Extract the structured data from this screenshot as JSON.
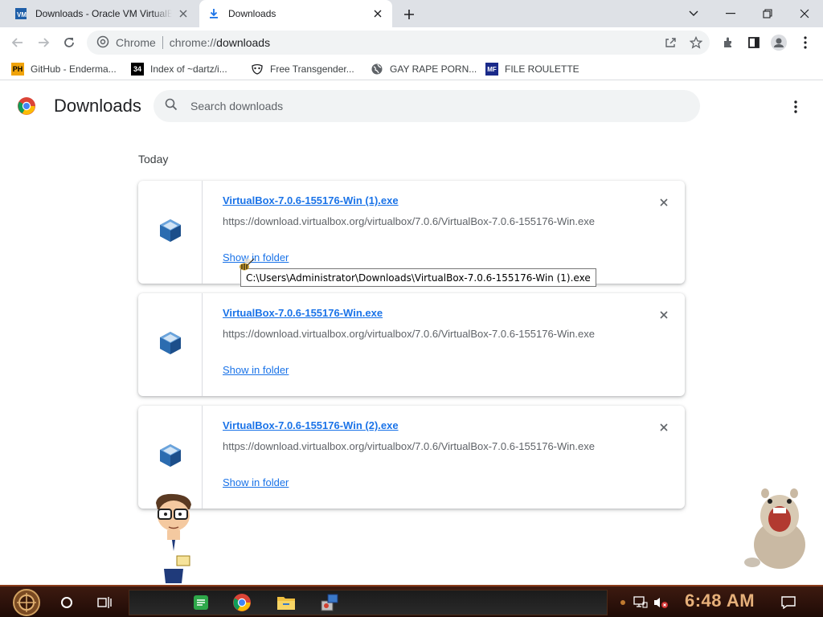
{
  "browser": {
    "tabs": [
      {
        "title": "Downloads - Oracle VM VirtualBox",
        "active": false,
        "favicon": "virtualbox-manual-icon"
      },
      {
        "title": "Downloads",
        "active": true,
        "favicon": "download-icon"
      }
    ],
    "omnibox": {
      "chip": "Chrome",
      "scheme": "chrome://",
      "path": "downloads"
    }
  },
  "bookmarks": [
    {
      "label": "GitHub - Enderma...",
      "icon": "PH"
    },
    {
      "label": "Index of ~dartz/i...",
      "icon": "34"
    },
    {
      "label": "Free Transgender...",
      "icon": "mask-icon"
    },
    {
      "label": "GAY RAPE PORN...",
      "icon": "globe-icon"
    },
    {
      "label": "FILE ROULETTE",
      "icon": "MF"
    }
  ],
  "downloads_page": {
    "title": "Downloads",
    "search_placeholder": "Search downloads",
    "date_label": "Today",
    "items": [
      {
        "name": "VirtualBox-7.0.6-155176-Win (1).exe",
        "url": "https://download.virtualbox.org/virtualbox/7.0.6/VirtualBox-7.0.6-155176-Win.exe",
        "action": "Show in folder"
      },
      {
        "name": "VirtualBox-7.0.6-155176-Win.exe",
        "url": "https://download.virtualbox.org/virtualbox/7.0.6/VirtualBox-7.0.6-155176-Win.exe",
        "action": "Show in folder"
      },
      {
        "name": "VirtualBox-7.0.6-155176-Win (2).exe",
        "url": "https://download.virtualbox.org/virtualbox/7.0.6/VirtualBox-7.0.6-155176-Win.exe",
        "action": "Show in folder"
      }
    ],
    "tooltip": "C:\\Users\\Administrator\\Downloads\\VirtualBox-7.0.6-155176-Win (1).exe"
  },
  "taskbar": {
    "clock": "6:48 AM",
    "items": [
      "start-orb-icon",
      "cortana-icon",
      "task-view-icon",
      "notes-app-icon",
      "chrome-icon",
      "file-explorer-icon",
      "installer-icon"
    ]
  },
  "colors": {
    "link": "#1a73e8",
    "tabstrip": "#dee1e6",
    "omnibox": "#f1f3f4",
    "clock": "#e6b07a"
  }
}
